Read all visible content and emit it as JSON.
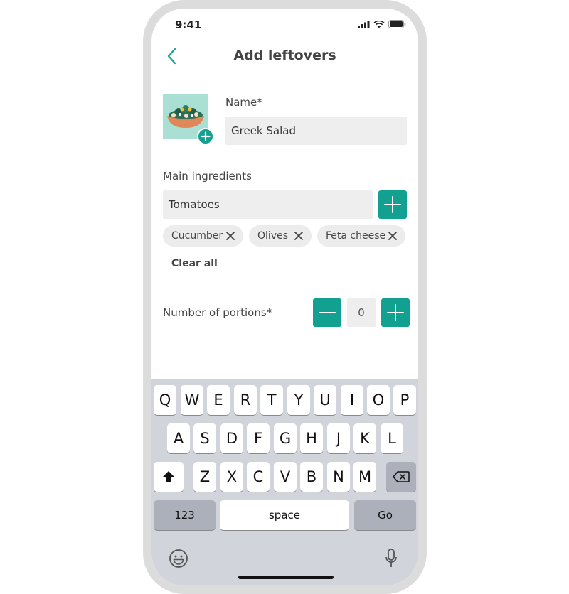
{
  "status_bar": {
    "time": "9:41",
    "icons": [
      "cellular-signal-icon",
      "wifi-icon",
      "battery-icon"
    ]
  },
  "nav": {
    "title": "Add leftovers",
    "back_icon": "chevron-left-icon"
  },
  "name_field": {
    "label": "Name*",
    "value": "Greek Salad"
  },
  "photo": {
    "icon": "salad-bowl-icon",
    "add_icon": "plus-circle-icon"
  },
  "ingredients": {
    "label": "Main ingredients",
    "input_value": "Tomatoes",
    "chips": [
      "Cucumber",
      "Olives",
      "Feta cheese"
    ],
    "clear_label": "Clear all"
  },
  "portions": {
    "label": "Number of portions*",
    "value": "0"
  },
  "keyboard": {
    "row1": [
      "Q",
      "W",
      "E",
      "R",
      "T",
      "Y",
      "U",
      "I",
      "O",
      "P"
    ],
    "row2": [
      "A",
      "S",
      "D",
      "F",
      "G",
      "H",
      "J",
      "K",
      "L"
    ],
    "row3": [
      "Z",
      "X",
      "C",
      "V",
      "B",
      "N",
      "M"
    ],
    "numbers_label": "123",
    "space_label": "space",
    "go_label": "Go"
  },
  "colors": {
    "accent": "#12a191",
    "field_bg": "#eeeeee",
    "keyboard_bg": "#d1d5db"
  }
}
